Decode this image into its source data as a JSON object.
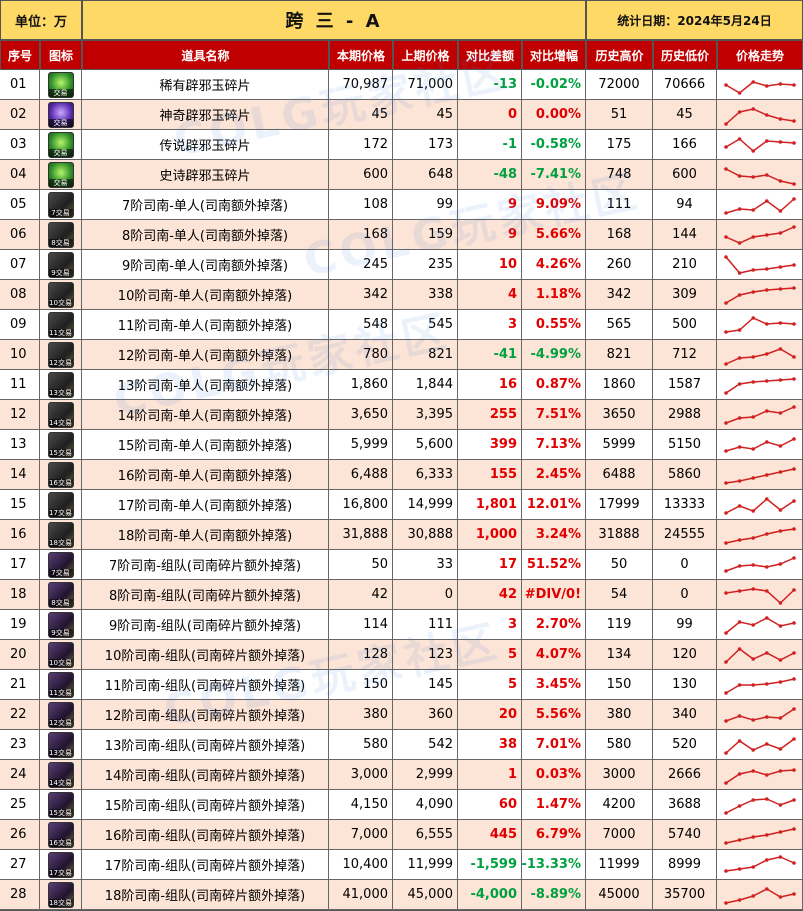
{
  "header": {
    "unit_label": "单位：万",
    "title": "跨 三 - A",
    "date_label": "统计日期：2024年5月24日"
  },
  "columns": [
    "序号",
    "图标",
    "道具名称",
    "本期价格",
    "上期价格",
    "对比差额",
    "对比增幅",
    "历史高价",
    "历史低价",
    "价格走势"
  ],
  "watermark": "COLG玩家社区",
  "colors": {
    "header_bg": "#ffd966",
    "column_header_bg": "#c00000",
    "row_alt_bg": "#fce4d6",
    "increase": "#e00000",
    "decrease": "#00a040",
    "sparkline": "#d02020"
  },
  "rows": [
    {
      "no": "01",
      "icon": "green-jade-shard-icon",
      "icon_tag": "交易",
      "name": "稀有辟邪玉碎片",
      "cur": "70,987",
      "prev": "71,000",
      "diff": "-13",
      "pct": "-0.02%",
      "high": "72000",
      "low": "70666",
      "dir": "down",
      "spark": [
        0.5,
        0.9,
        0.35,
        0.55,
        0.45,
        0.5
      ]
    },
    {
      "no": "02",
      "icon": "purple-jade-shard-icon",
      "icon_tag": "交易",
      "name": "神奇辟邪玉碎片",
      "cur": "45",
      "prev": "45",
      "diff": "0",
      "pct": "0.00%",
      "high": "51",
      "low": "45",
      "dir": "up",
      "spark": [
        0.95,
        0.35,
        0.2,
        0.5,
        0.7,
        0.8
      ]
    },
    {
      "no": "03",
      "icon": "green-jade-shard-icon",
      "icon_tag": "交易",
      "name": "传说辟邪玉碎片",
      "cur": "172",
      "prev": "173",
      "diff": "-1",
      "pct": "-0.58%",
      "high": "175",
      "low": "166",
      "dir": "down",
      "spark": [
        0.6,
        0.2,
        0.8,
        0.3,
        0.35,
        0.4
      ]
    },
    {
      "no": "04",
      "icon": "green-jade-shard-icon",
      "icon_tag": "交易",
      "name": "史诗辟邪玉碎片",
      "cur": "600",
      "prev": "648",
      "diff": "-48",
      "pct": "-7.41%",
      "high": "748",
      "low": "600",
      "dir": "down",
      "spark": [
        0.2,
        0.55,
        0.6,
        0.5,
        0.8,
        0.95
      ]
    },
    {
      "no": "05",
      "icon": "compass-7-icon",
      "icon_tag": "7交易",
      "name": "7阶司南-单人(司南额外掉落)",
      "cur": "108",
      "prev": "99",
      "diff": "9",
      "pct": "9.09%",
      "high": "111",
      "low": "94",
      "dir": "up",
      "spark": [
        0.9,
        0.7,
        0.75,
        0.3,
        0.8,
        0.2
      ]
    },
    {
      "no": "06",
      "icon": "compass-8-icon",
      "icon_tag": "8交易",
      "name": "8阶司南-单人(司南额外掉落)",
      "cur": "168",
      "prev": "159",
      "diff": "9",
      "pct": "5.66%",
      "high": "168",
      "low": "144",
      "dir": "up",
      "spark": [
        0.6,
        0.9,
        0.6,
        0.5,
        0.4,
        0.1
      ]
    },
    {
      "no": "07",
      "icon": "compass-9-icon",
      "icon_tag": "9交易",
      "name": "9阶司南-单人(司南额外掉落)",
      "cur": "245",
      "prev": "235",
      "diff": "10",
      "pct": "4.26%",
      "high": "260",
      "low": "210",
      "dir": "up",
      "spark": [
        0.1,
        0.9,
        0.75,
        0.7,
        0.6,
        0.5
      ]
    },
    {
      "no": "08",
      "icon": "compass-10-icon",
      "icon_tag": "10交易",
      "name": "10阶司南-单人(司南额外掉落)",
      "cur": "342",
      "prev": "338",
      "diff": "4",
      "pct": "1.18%",
      "high": "342",
      "low": "309",
      "dir": "up",
      "spark": [
        0.9,
        0.5,
        0.35,
        0.25,
        0.2,
        0.15
      ]
    },
    {
      "no": "09",
      "icon": "compass-11-icon",
      "icon_tag": "11交易",
      "name": "11阶司南-单人(司南额外掉落)",
      "cur": "548",
      "prev": "545",
      "diff": "3",
      "pct": "0.55%",
      "high": "565",
      "low": "500",
      "dir": "up",
      "spark": [
        0.85,
        0.75,
        0.15,
        0.45,
        0.4,
        0.45
      ]
    },
    {
      "no": "10",
      "icon": "compass-12-icon",
      "icon_tag": "12交易",
      "name": "12阶司南-单人(司南额外掉落)",
      "cur": "780",
      "prev": "821",
      "diff": "-41",
      "pct": "-4.99%",
      "high": "821",
      "low": "712",
      "dir": "down",
      "spark": [
        0.95,
        0.65,
        0.6,
        0.45,
        0.2,
        0.6
      ]
    },
    {
      "no": "11",
      "icon": "compass-13-icon",
      "icon_tag": "13交易",
      "name": "13阶司南-单人(司南额外掉落)",
      "cur": "1,860",
      "prev": "1,844",
      "diff": "16",
      "pct": "0.87%",
      "high": "1860",
      "low": "1587",
      "dir": "up",
      "spark": [
        0.9,
        0.45,
        0.35,
        0.3,
        0.25,
        0.2
      ]
    },
    {
      "no": "12",
      "icon": "compass-14-icon",
      "icon_tag": "14交易",
      "name": "14阶司南-单人(司南额外掉落)",
      "cur": "3,650",
      "prev": "3,395",
      "diff": "255",
      "pct": "7.51%",
      "high": "3650",
      "low": "2988",
      "dir": "up",
      "spark": [
        0.9,
        0.65,
        0.6,
        0.3,
        0.4,
        0.1
      ]
    },
    {
      "no": "13",
      "icon": "compass-15-icon",
      "icon_tag": "15交易",
      "name": "15阶司南-单人(司南额外掉落)",
      "cur": "5,999",
      "prev": "5,600",
      "diff": "399",
      "pct": "7.13%",
      "high": "5999",
      "low": "5150",
      "dir": "up",
      "spark": [
        0.8,
        0.6,
        0.7,
        0.35,
        0.55,
        0.2
      ]
    },
    {
      "no": "14",
      "icon": "compass-16-icon",
      "icon_tag": "16交易",
      "name": "16阶司南-单人(司南额外掉落)",
      "cur": "6,488",
      "prev": "6,333",
      "diff": "155",
      "pct": "2.45%",
      "high": "6488",
      "low": "5860",
      "dir": "up",
      "spark": [
        0.9,
        0.8,
        0.65,
        0.5,
        0.35,
        0.2
      ]
    },
    {
      "no": "15",
      "icon": "compass-17-icon",
      "icon_tag": "17交易",
      "name": "17阶司南-单人(司南额外掉落)",
      "cur": "16,800",
      "prev": "14,999",
      "diff": "1,801",
      "pct": "12.01%",
      "high": "17999",
      "low": "13333",
      "dir": "up",
      "spark": [
        0.9,
        0.55,
        0.8,
        0.2,
        0.75,
        0.3
      ]
    },
    {
      "no": "16",
      "icon": "compass-18-icon",
      "icon_tag": "18交易",
      "name": "18阶司南-单人(司南额外掉落)",
      "cur": "31,888",
      "prev": "30,888",
      "diff": "1,000",
      "pct": "3.24%",
      "high": "31888",
      "low": "24555",
      "dir": "up",
      "spark": [
        0.9,
        0.75,
        0.65,
        0.45,
        0.3,
        0.2
      ]
    },
    {
      "no": "17",
      "icon": "team-compass-7-icon",
      "icon_tag": "7交易",
      "name": "7阶司南-组队(司南碎片额外掉落)",
      "cur": "50",
      "prev": "33",
      "diff": "17",
      "pct": "51.52%",
      "high": "50",
      "low": "0",
      "dir": "up",
      "spark": [
        0.8,
        0.55,
        0.5,
        0.6,
        0.45,
        0.15
      ]
    },
    {
      "no": "18",
      "icon": "team-compass-8-icon",
      "icon_tag": "8交易",
      "name": "8阶司南-组队(司南碎片额外掉落)",
      "cur": "42",
      "prev": "0",
      "diff": "42",
      "pct": "#DIV/0!",
      "high": "54",
      "low": "0",
      "dir": "up",
      "spark": [
        0.4,
        0.3,
        0.2,
        0.3,
        0.9,
        0.25
      ]
    },
    {
      "no": "19",
      "icon": "team-compass-9-icon",
      "icon_tag": "9交易",
      "name": "9阶司南-组队(司南碎片额外掉落)",
      "cur": "114",
      "prev": "111",
      "diff": "3",
      "pct": "2.70%",
      "high": "119",
      "low": "99",
      "dir": "up",
      "spark": [
        0.9,
        0.35,
        0.5,
        0.15,
        0.55,
        0.4
      ]
    },
    {
      "no": "20",
      "icon": "team-compass-10-icon",
      "icon_tag": "10交易",
      "name": "10阶司南-组队(司南碎片额外掉落)",
      "cur": "128",
      "prev": "123",
      "diff": "5",
      "pct": "4.07%",
      "high": "134",
      "low": "120",
      "dir": "up",
      "spark": [
        0.85,
        0.2,
        0.7,
        0.4,
        0.75,
        0.4
      ]
    },
    {
      "no": "21",
      "icon": "team-compass-11-icon",
      "icon_tag": "11交易",
      "name": "11阶司南-组队(司南碎片额外掉落)",
      "cur": "150",
      "prev": "145",
      "diff": "5",
      "pct": "3.45%",
      "high": "150",
      "low": "130",
      "dir": "up",
      "spark": [
        0.9,
        0.5,
        0.5,
        0.45,
        0.35,
        0.2
      ]
    },
    {
      "no": "22",
      "icon": "team-compass-12-icon",
      "icon_tag": "12交易",
      "name": "12阶司南-组队(司南碎片额外掉落)",
      "cur": "380",
      "prev": "360",
      "diff": "20",
      "pct": "5.56%",
      "high": "380",
      "low": "340",
      "dir": "up",
      "spark": [
        0.8,
        0.55,
        0.75,
        0.6,
        0.65,
        0.2
      ]
    },
    {
      "no": "23",
      "icon": "team-compass-13-icon",
      "icon_tag": "13交易",
      "name": "13阶司南-组队(司南碎片额外掉落)",
      "cur": "580",
      "prev": "542",
      "diff": "38",
      "pct": "7.01%",
      "high": "580",
      "low": "520",
      "dir": "up",
      "spark": [
        0.9,
        0.3,
        0.75,
        0.45,
        0.7,
        0.2
      ]
    },
    {
      "no": "24",
      "icon": "team-compass-14-icon",
      "icon_tag": "14交易",
      "name": "14阶司南-组队(司南碎片额外掉落)",
      "cur": "3,000",
      "prev": "2,999",
      "diff": "1",
      "pct": "0.03%",
      "high": "3000",
      "low": "2666",
      "dir": "up",
      "spark": [
        0.9,
        0.45,
        0.3,
        0.5,
        0.3,
        0.25
      ]
    },
    {
      "no": "25",
      "icon": "team-compass-15-icon",
      "icon_tag": "15交易",
      "name": "15阶司南-组队(司南碎片额外掉落)",
      "cur": "4,150",
      "prev": "4,090",
      "diff": "60",
      "pct": "1.47%",
      "high": "4200",
      "low": "3688",
      "dir": "up",
      "spark": [
        0.9,
        0.55,
        0.25,
        0.2,
        0.5,
        0.25
      ]
    },
    {
      "no": "26",
      "icon": "team-compass-16-icon",
      "icon_tag": "16交易",
      "name": "16阶司南-组队(司南碎片额外掉落)",
      "cur": "7,000",
      "prev": "6,555",
      "diff": "445",
      "pct": "6.79%",
      "high": "7000",
      "low": "5740",
      "dir": "up",
      "spark": [
        0.9,
        0.75,
        0.6,
        0.5,
        0.35,
        0.2
      ]
    },
    {
      "no": "27",
      "icon": "team-compass-17-icon",
      "icon_tag": "17交易",
      "name": "17阶司南-组队(司南碎片额外掉落)",
      "cur": "10,400",
      "prev": "11,999",
      "diff": "-1,599",
      "pct": "-13.33%",
      "high": "11999",
      "low": "8999",
      "dir": "down",
      "spark": [
        0.8,
        0.7,
        0.6,
        0.25,
        0.1,
        0.4
      ]
    },
    {
      "no": "28",
      "icon": "team-compass-18-icon",
      "icon_tag": "18交易",
      "name": "18阶司南-组队(司南碎片额外掉落)",
      "cur": "41,000",
      "prev": "45,000",
      "diff": "-4,000",
      "pct": "-8.89%",
      "high": "45000",
      "low": "35700",
      "dir": "down",
      "spark": [
        0.9,
        0.75,
        0.55,
        0.2,
        0.6,
        0.45
      ]
    }
  ]
}
